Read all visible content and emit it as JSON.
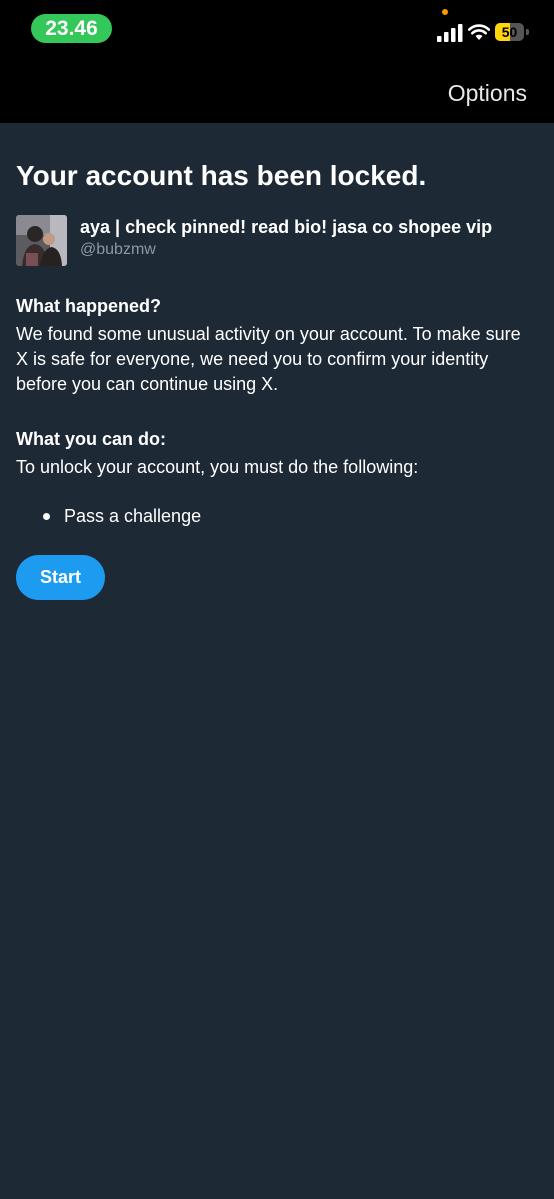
{
  "status_bar": {
    "time": "23.46",
    "battery_percent": 50,
    "battery_label": "50",
    "icons": [
      "signal-icon",
      "wifi-icon",
      "battery-icon",
      "privacy-indicator-dot"
    ]
  },
  "nav": {
    "options_label": "Options"
  },
  "page": {
    "title": "Your account has been locked."
  },
  "account": {
    "display_name": "aya | check pinned! read bio! jasa co shopee vip",
    "handle": "@bubzmw"
  },
  "what_happened": {
    "heading": "What happened?",
    "body": "We found some unusual activity on your account. To make sure X is safe for everyone, we need you to confirm your identity before you can continue using X."
  },
  "what_you_can_do": {
    "heading": "What you can do:",
    "body": "To unlock your account, you must do the following:",
    "steps": [
      "Pass a challenge"
    ]
  },
  "actions": {
    "start_label": "Start"
  },
  "colors": {
    "background": "#1e2936",
    "bar": "#000000",
    "accent": "#1d9bf0",
    "time_pill": "#34c759",
    "battery": "#ffd60a",
    "handle_text": "#8b98a5"
  }
}
